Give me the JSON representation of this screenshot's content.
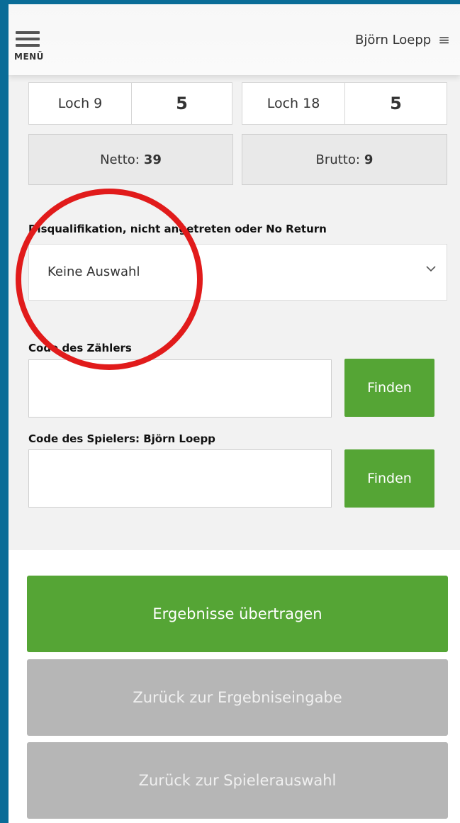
{
  "header": {
    "menu_label": "MENÜ",
    "user_name": "Björn Loepp"
  },
  "scores": {
    "hole9_label": "Loch 9",
    "hole9_value": "5",
    "hole18_label": "Loch 18",
    "hole18_value": "5",
    "netto_label": "Netto:",
    "netto_value": "39",
    "brutto_label": "Brutto:",
    "brutto_value": "9"
  },
  "disqualification": {
    "label": "Disqualifikation, nicht angetreten oder No Return",
    "selected": "Keine Auswahl"
  },
  "marker_code": {
    "label": "Code des Zählers",
    "value": "",
    "button": "Finden"
  },
  "player_code": {
    "label": "Code des Spielers: Björn Loepp",
    "value": "",
    "button": "Finden"
  },
  "actions": {
    "submit": "Ergebnisse übertragen",
    "back_to_scores": "Zurück zur Ergebniseingabe",
    "back_to_players": "Zurück zur Spielerauswahl"
  },
  "colors": {
    "primary_green": "#55a535",
    "disabled_grey": "#b6b6b6",
    "annotation_red": "#e11b1b",
    "frame_blue": "#0a6c97"
  }
}
